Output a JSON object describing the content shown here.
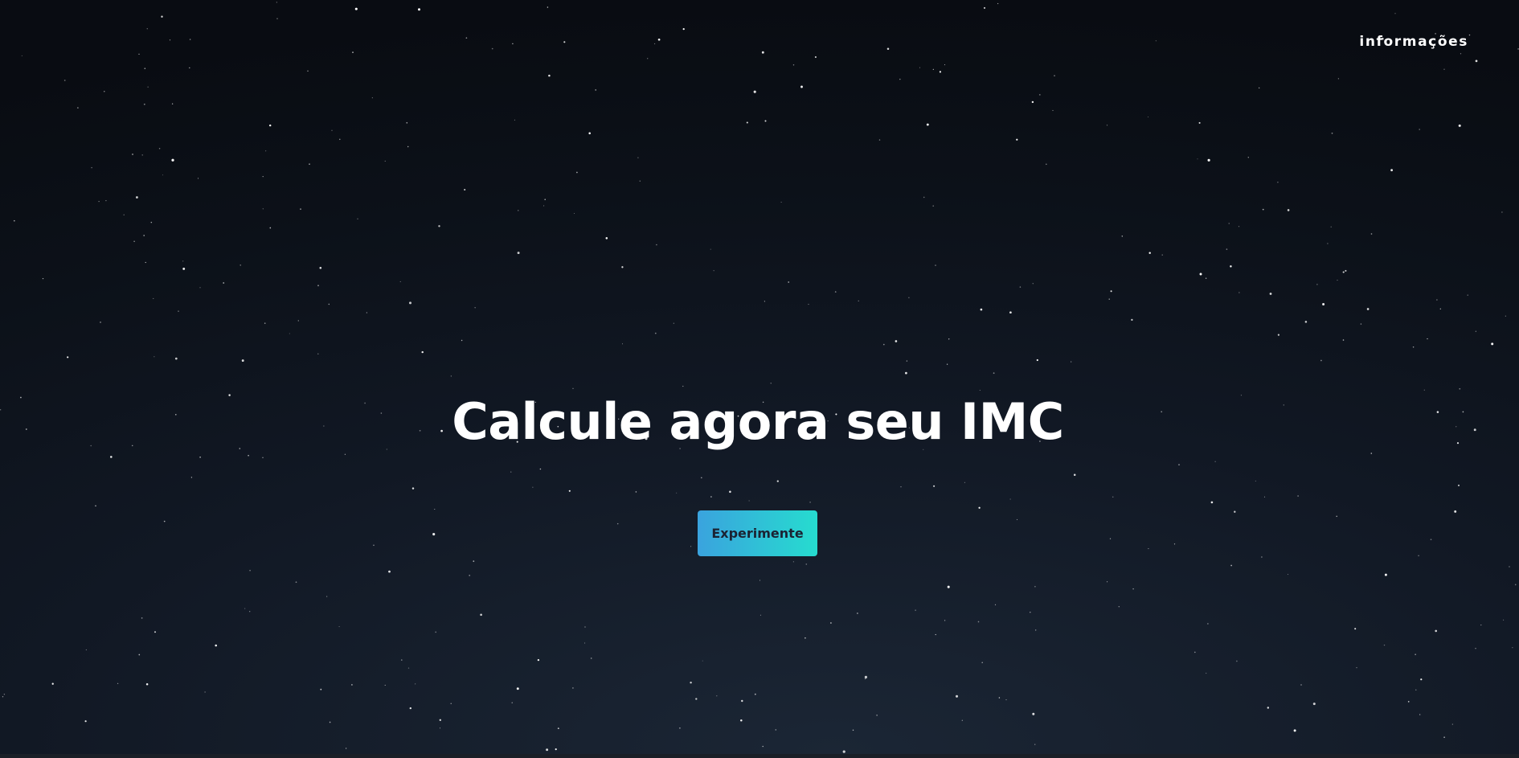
{
  "nav": {
    "info_label": "informações"
  },
  "hero": {
    "title": "Calcule agora seu IMC",
    "cta_label": "Experimente"
  },
  "colors": {
    "background": "#0b0f16",
    "cta_gradient_start": "#3aa3de",
    "cta_gradient_end": "#26dccf",
    "cta_text": "#1b2333",
    "title_text": "#ffffff"
  }
}
